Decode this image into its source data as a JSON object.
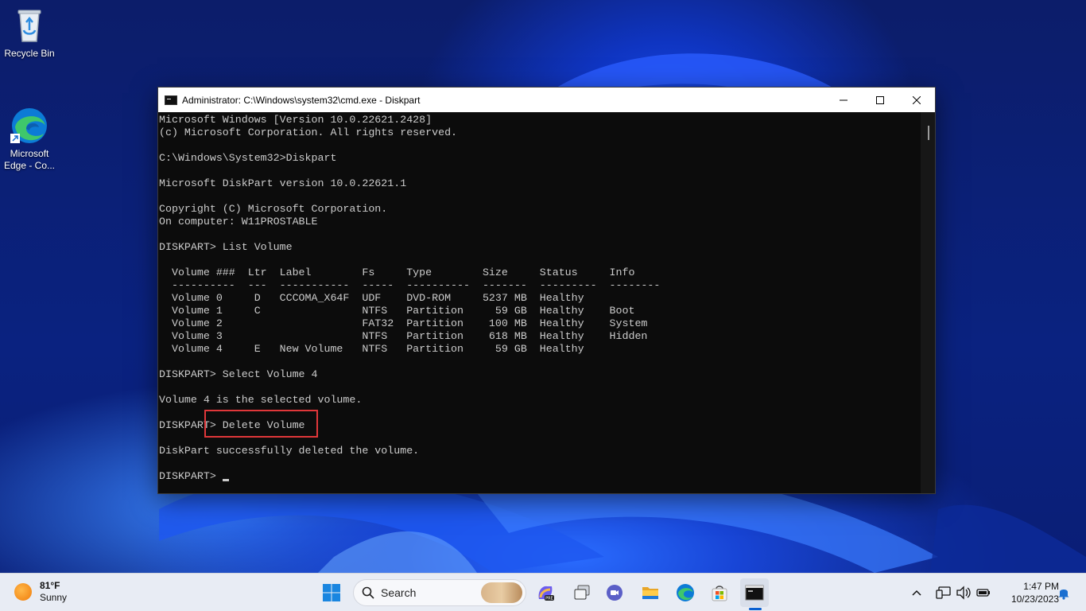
{
  "desktop": {
    "icons": [
      {
        "label": "Recycle Bin",
        "icon": "recycle-bin-icon"
      },
      {
        "label": "Microsoft\nEdge - Co...",
        "icon": "edge-icon"
      }
    ]
  },
  "window": {
    "title": "Administrator: C:\\Windows\\system32\\cmd.exe - Diskpart",
    "minimize": "—",
    "maximize": "☐",
    "close": "✕"
  },
  "console": {
    "lines": [
      "Microsoft Windows [Version 10.0.22621.2428]",
      "(c) Microsoft Corporation. All rights reserved.",
      "",
      "C:\\Windows\\System32>Diskpart",
      "",
      "Microsoft DiskPart version 10.0.22621.1",
      "",
      "Copyright (C) Microsoft Corporation.",
      "On computer: W11PROSTABLE",
      "",
      "DISKPART> List Volume",
      "",
      "  Volume ###  Ltr  Label        Fs     Type        Size     Status     Info",
      "  ----------  ---  -----------  -----  ----------  -------  ---------  --------",
      "  Volume 0     D   CCCOMA_X64F  UDF    DVD-ROM     5237 MB  Healthy",
      "  Volume 1     C                NTFS   Partition     59 GB  Healthy    Boot",
      "  Volume 2                      FAT32  Partition    100 MB  Healthy    System",
      "  Volume 3                      NTFS   Partition    618 MB  Healthy    Hidden",
      "  Volume 4     E   New Volume   NTFS   Partition     59 GB  Healthy",
      "",
      "DISKPART> Select Volume 4",
      "",
      "Volume 4 is the selected volume.",
      "",
      "DISKPART> Delete Volume",
      "",
      "DiskPart successfully deleted the volume.",
      ""
    ],
    "prompt": "DISKPART> "
  },
  "taskbar": {
    "weather": {
      "temp": "81°F",
      "condition": "Sunny"
    },
    "search_label": "Search",
    "apps": [
      "copilot-icon",
      "task-view-icon",
      "teams-meet-icon",
      "file-explorer-icon",
      "edge-icon",
      "store-icon",
      "terminal-icon"
    ],
    "clock": {
      "time": "1:47 PM",
      "date": "10/23/2023"
    }
  }
}
